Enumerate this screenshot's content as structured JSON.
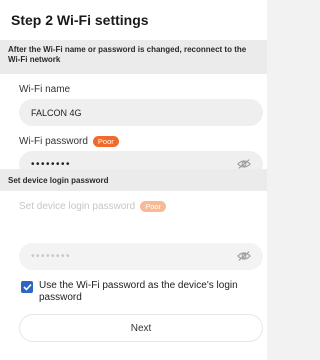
{
  "header": {
    "title": "Step 2 Wi-Fi settings"
  },
  "notice": "After the Wi-Fi name or password is changed, reconnect to the Wi-Fi network",
  "wifi_name": {
    "label": "Wi-Fi name",
    "value": "FALCON 4G"
  },
  "wifi_password": {
    "label": "Wi-Fi password",
    "strength": "Poor",
    "value": "••••••••"
  },
  "device_section": {
    "title": "Set device login password"
  },
  "device_password": {
    "label": "Set device login password",
    "strength": "Poor",
    "value": "••••••••"
  },
  "use_wifi_password": {
    "checked": true,
    "label": "Use the Wi-Fi password as the device's login password"
  },
  "next_button": {
    "label": "Next"
  },
  "colors": {
    "accent": "#2d64c8",
    "badge": "#ef6a2b"
  }
}
